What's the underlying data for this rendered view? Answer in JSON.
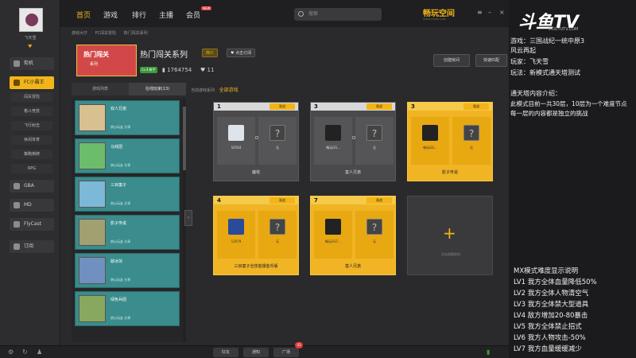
{
  "sidebar": {
    "username": "飞天雪",
    "items": [
      {
        "label": "街机"
      },
      {
        "label": "FC小霸王"
      },
      {
        "label": "GBA"
      },
      {
        "label": "MD"
      },
      {
        "label": "FlyCast"
      },
      {
        "label": "订阅"
      }
    ],
    "sub_items": [
      "闯关冒险",
      "格斗竞技",
      "飞行射击",
      "休闲体育",
      "策略棋牌",
      "RPG"
    ]
  },
  "topnav": {
    "items": [
      "首页",
      "游戏",
      "排行",
      "主播",
      "会员"
    ],
    "new_badge": "NEW",
    "search_placeholder": "搜索",
    "logo": "畅玩空间",
    "logo_sub": "WWW.CHANG.COM"
  },
  "breadcrumb": [
    "游戏大厅",
    "FC闯关冒险",
    "热门闯关系列"
  ],
  "header": {
    "banner_text": "热门闯关",
    "banner_sub": "系列",
    "title": "热门闯关系列",
    "tag1": "简介",
    "tag2": "♥ 点击订阅",
    "level": "Lv.3 新手",
    "plays": "1764754",
    "likes": "11",
    "create_room": "创建房间",
    "quick_match": "快速匹配"
  },
  "tabs": {
    "list": "游戏列表",
    "online": "在线玩家(13)"
  },
  "right_header": {
    "label": "当前游戏系列",
    "value": "全部游戏"
  },
  "games": [
    {
      "name": "双人兄弟",
      "meta": "热心玩友   分享"
    },
    {
      "name": "马戏团",
      "meta": "热心玩友   分享"
    },
    {
      "name": "三目童子",
      "meta": "热心玩友   分享"
    },
    {
      "name": "影子传说",
      "meta": "热心玩友   分享"
    },
    {
      "name": "敲冰块",
      "meta": "热心玩友   分享"
    },
    {
      "name": "绿色兵团",
      "meta": "热心玩友   分享"
    }
  ],
  "cards": [
    {
      "num": "1",
      "left_label": "54564",
      "right_label": "无",
      "footer": "魔塔",
      "gold": false
    },
    {
      "num": "3",
      "left_label": "畅玩GS...",
      "right_label": "无",
      "footer": "富人兄弟",
      "gold": false
    },
    {
      "num": "3",
      "left_label": "畅玩GS...",
      "right_label": "无",
      "footer": "影子传说",
      "gold": true
    },
    {
      "num": "4",
      "left_label": "12079",
      "right_label": "无",
      "footer": "三目童子全技能爆金币版",
      "gold": true
    },
    {
      "num": "7",
      "left_label": "畅玩GS7...",
      "right_label": "无",
      "footer": "富人兄弟",
      "gold": true
    }
  ],
  "view_label": "观战",
  "add_card_text": "点击创建房间",
  "bottom": {
    "friends": "好友",
    "notice": "通知",
    "plaza": "广场",
    "plaza_badge": "43"
  },
  "overlay": {
    "logo": "斗鱼TV",
    "logo_sub": "DOUYUTV.COM",
    "lines": [
      "游戏：三国战纪一统中原3",
      "      风云再起",
      "玩家：飞天雪",
      "玩法：新模式通天塔测试"
    ],
    "intro_lines": [
      "通天塔内容介绍：",
      "此模式目前一共30层，10层为一个难度节点",
      "每一层的内容都是独立的挑战"
    ],
    "mx_lines": [
      "MX模式难度显示说明",
      "LV1 我方全体血量降低50%",
      "LV2 我方全体人物清空气",
      "LV3 我方全体禁大型道具",
      "LV4 敌方增加20-80暴击",
      "LV5 我方全体禁止招式",
      "LV6 我方人物攻击-50%",
      "LV7 我方血量缓缓减少"
    ]
  },
  "colors": {
    "accent": "#f2b519",
    "card_gold": "#f0b424",
    "list_teal": "#3b8c8c"
  }
}
